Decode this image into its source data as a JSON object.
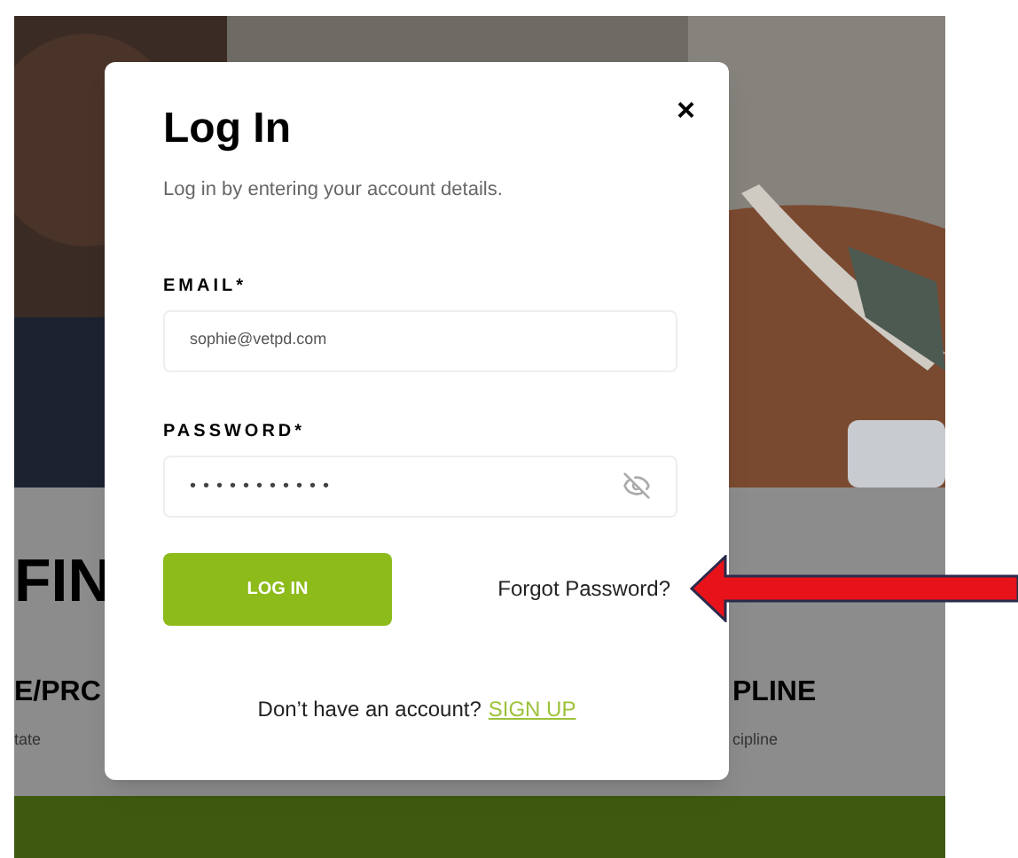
{
  "background": {
    "heading_left": "FIN",
    "column_1": {
      "title": "E/PRC",
      "subtitle": "tate"
    },
    "column_2": {
      "title": "PLINE",
      "subtitle": "cipline"
    }
  },
  "dialog": {
    "title": "Log In",
    "subtitle": "Log in by entering your account details.",
    "close": "×",
    "fields": [
      {
        "kind": "text",
        "label": "EMAIL*",
        "value": "sophie@vetpd.com"
      },
      {
        "kind": "password",
        "label": "PASSWORD*",
        "value": "•••••••••••"
      }
    ],
    "login_button": "LOG IN",
    "forgot_link": "Forgot Password?",
    "signup_prompt": "Don’t have an account?",
    "signup_link": "SIGN UP"
  }
}
